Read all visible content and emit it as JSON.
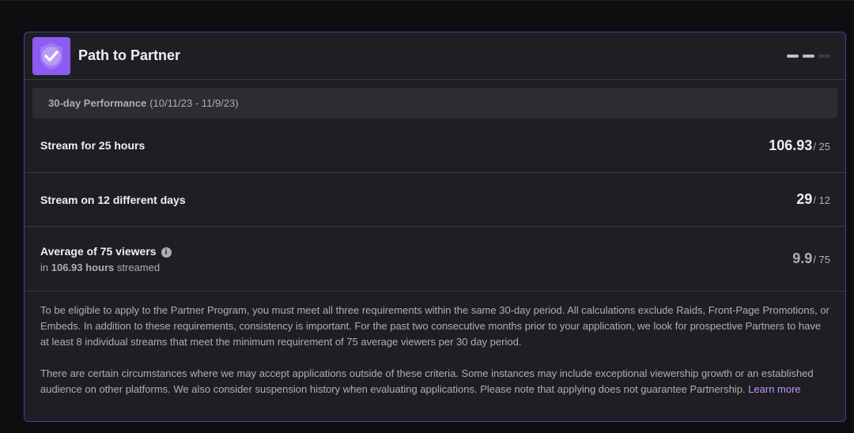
{
  "card": {
    "title": "Path to Partner",
    "icon": "checkmark-badge-icon",
    "accent_color": "#8c5cf0",
    "border_color": "#5c32a8"
  },
  "performance": {
    "label": "30-day Performance",
    "range": "(10/11/23 - 11/9/23)"
  },
  "requirements": [
    {
      "title": "Stream for 25 hours",
      "value": "106.93",
      "target": "/ 25"
    },
    {
      "title": "Stream on 12 different days",
      "value": "29",
      "target": "/ 12"
    },
    {
      "title": "Average of 75 viewers",
      "sub_prefix": "in",
      "sub_hours": "106.93 hours",
      "sub_suffix": "streamed",
      "value": "9.9",
      "target": "/ 75"
    }
  ],
  "info": {
    "paragraph1": "To be eligible to apply to the Partner Program, you must meet all three requirements within the same 30-day period. All calculations exclude Raids, Front-Page Promotions, or Embeds. In addition to these requirements, consistency is important. For the past two consecutive months prior to your application, we look for prospective Partners to have at least 8 individual streams that meet the minimum requirement of 75 average viewers per 30 day period.",
    "paragraph2": "There are certain circumstances where we may accept applications outside of these criteria. Some instances may include exceptional viewership growth or an established audience on other platforms. We also consider suspension history when evaluating applications. Please note that applying does not guarantee Partnership.",
    "learn_more": "Learn more",
    "link_color": "#bf94ff"
  }
}
